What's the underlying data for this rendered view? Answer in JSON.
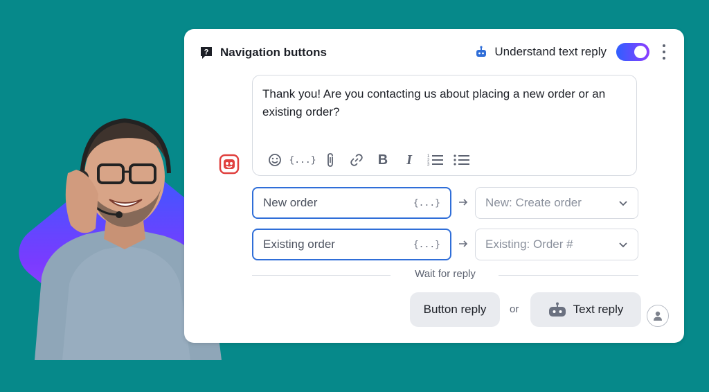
{
  "header": {
    "title": "Navigation buttons",
    "understand_label": "Understand text reply",
    "toggle_on": true
  },
  "message": {
    "text": "Thank you! Are you contacting us about placing a new order or an existing order?"
  },
  "toolbar": {
    "items": [
      "emoji-icon",
      "variable-icon",
      "attachment-icon",
      "link-icon",
      "bold-icon",
      "italic-icon",
      "numbered-list-icon",
      "bullet-list-icon"
    ],
    "variable_glyph": "{...}",
    "bold_glyph": "B",
    "italic_glyph": "I"
  },
  "buttons": [
    {
      "label": "New order",
      "var": "{...}",
      "target": "New: Create order"
    },
    {
      "label": "Existing order",
      "var": "{...}",
      "target": "Existing: Order #"
    }
  ],
  "wait_label": "Wait for reply",
  "replies": {
    "button_reply": "Button reply",
    "or": "or",
    "text_reply": "Text reply"
  },
  "colors": {
    "background": "#06898a",
    "accent_blue": "#2f6ed8",
    "toggle_gradient_start": "#2f5fff",
    "toggle_gradient_end": "#8c3dff",
    "bot_avatar": "#e0413f"
  }
}
